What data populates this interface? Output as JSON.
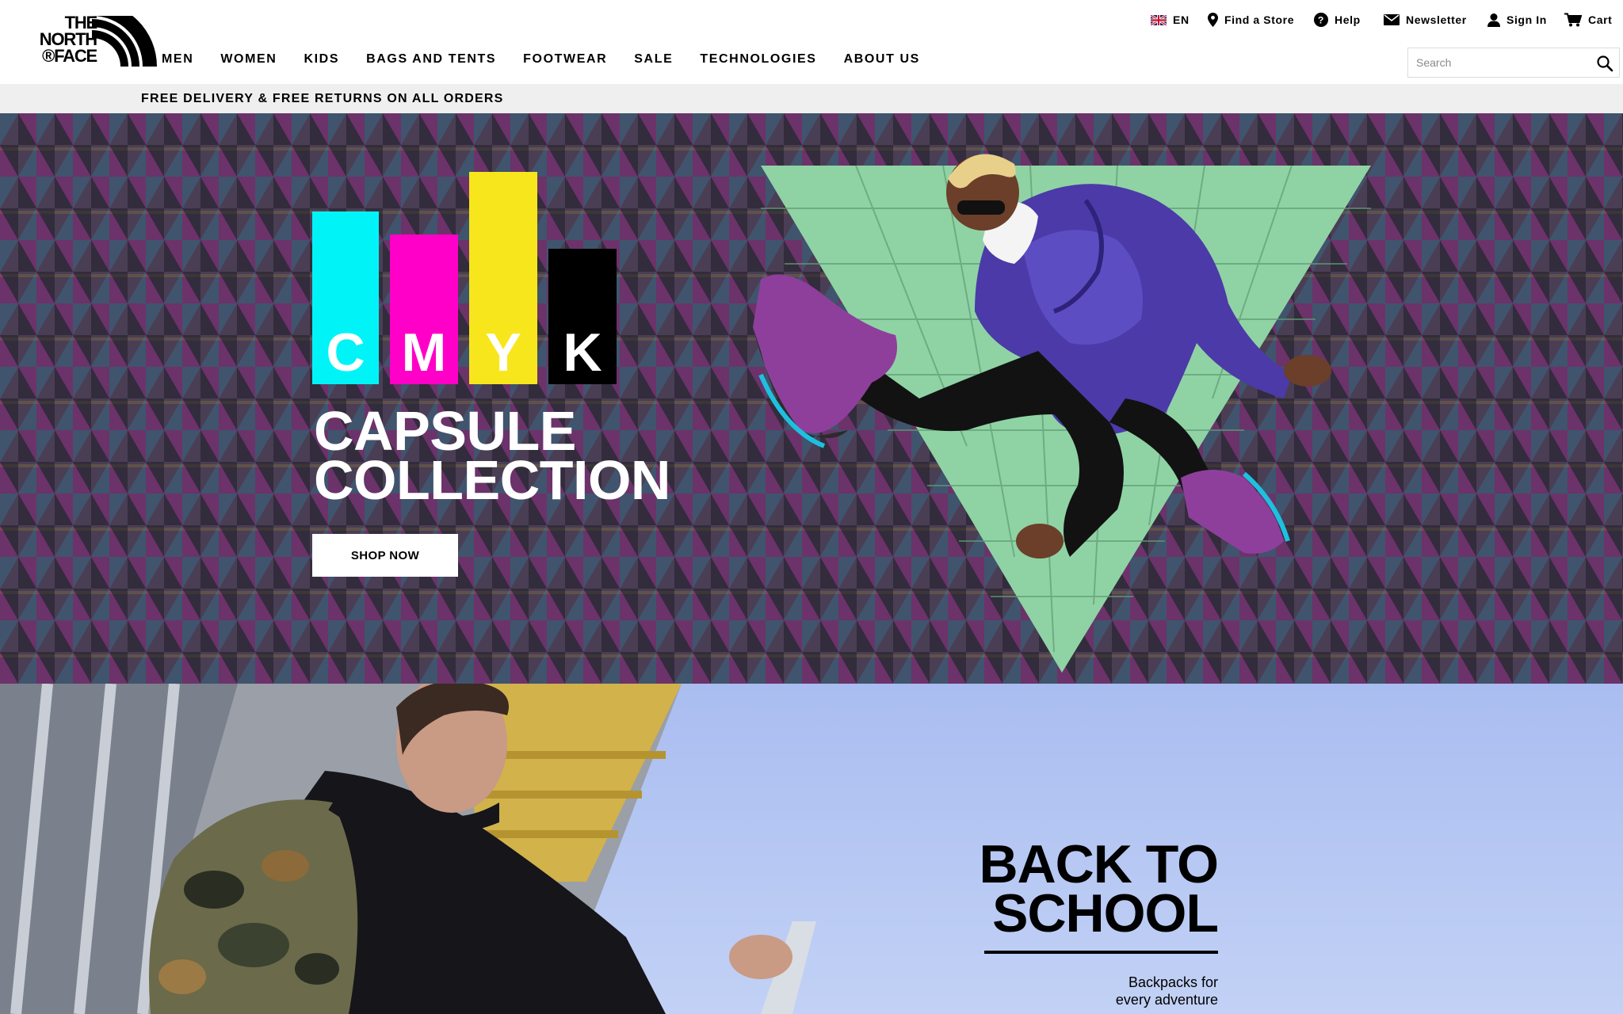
{
  "brand": {
    "line1": "THE",
    "line2": "NORTH",
    "line3": "®FACE"
  },
  "utility": {
    "language": "EN",
    "find_store": "Find a Store",
    "help": "Help",
    "newsletter": "Newsletter",
    "sign_in": "Sign In",
    "cart": "Cart"
  },
  "nav": {
    "items": [
      {
        "label": "MEN"
      },
      {
        "label": "WOMEN"
      },
      {
        "label": "KIDS"
      },
      {
        "label": "BAGS AND TENTS"
      },
      {
        "label": "FOOTWEAR"
      },
      {
        "label": "SALE"
      },
      {
        "label": "TECHNOLOGIES"
      },
      {
        "label": "ABOUT US"
      }
    ]
  },
  "search": {
    "placeholder": "Search"
  },
  "promo": {
    "text": "FREE DELIVERY & FREE RETURNS ON ALL ORDERS"
  },
  "hero1": {
    "letters": [
      "C",
      "M",
      "Y",
      "K"
    ],
    "title_line1": "CAPSULE",
    "title_line2": "COLLECTION",
    "cta": "SHOP NOW",
    "colors": {
      "cyan": "#00f4f7",
      "magenta": "#ff00c8",
      "yellow": "#f8e61c",
      "black": "#000000"
    }
  },
  "hero2": {
    "title_line1": "BACK TO",
    "title_line2": "SCHOOL",
    "sub_line1": "Backpacks for",
    "sub_line2": "every adventure"
  }
}
